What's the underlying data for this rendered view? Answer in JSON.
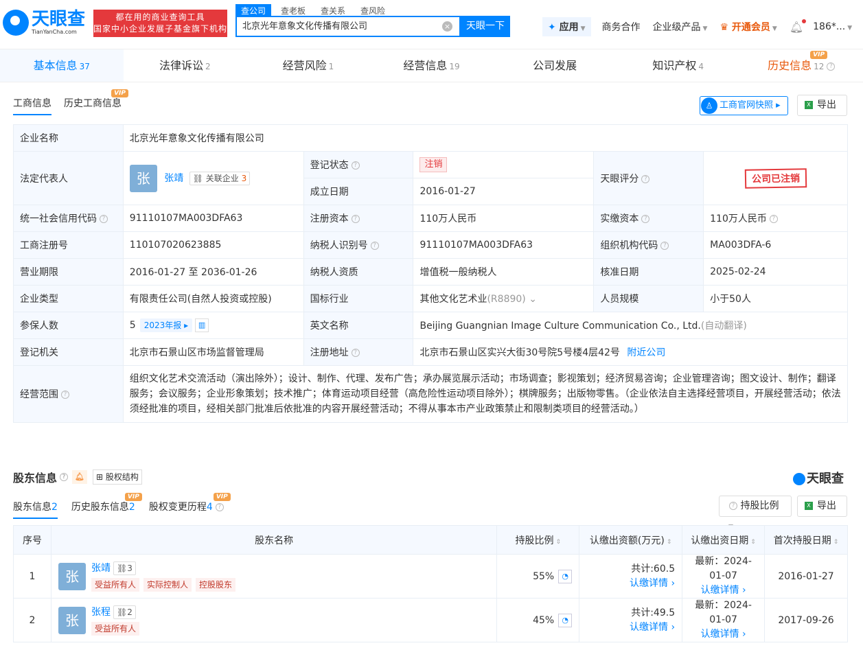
{
  "header": {
    "logo_cn": "天眼查",
    "logo_en": "TianYanCha.com",
    "promo_line1": "都在用的商业查询工具",
    "promo_line2": "国家中小企业发展子基金旗下机构",
    "search_tabs": [
      "查公司",
      "查老板",
      "查关系",
      "查风险"
    ],
    "search_value": "北京光年意象文化传播有限公司",
    "search_button": "天眼一下",
    "app_label": "应用",
    "nav_business": "商务合作",
    "nav_enterprise": "企业级产品",
    "nav_vip": "开通会员",
    "user": "186*..."
  },
  "main_tabs": [
    {
      "label": "基本信息",
      "count": "37"
    },
    {
      "label": "法律诉讼",
      "count": "2"
    },
    {
      "label": "经营风险",
      "count": "1"
    },
    {
      "label": "经营信息",
      "count": "19"
    },
    {
      "label": "公司发展",
      "count": ""
    },
    {
      "label": "知识产权",
      "count": "4"
    },
    {
      "label": "历史信息",
      "count": "12"
    }
  ],
  "vip_tag": "VIP",
  "subtabs": {
    "biz": "工商信息",
    "hist": "历史工商信息"
  },
  "buttons": {
    "snapshot": "工商官网快照",
    "export": "导出"
  },
  "info": {
    "name_k": "企业名称",
    "name_v": "北京光年意象文化传播有限公司",
    "legal_k": "法定代表人",
    "legal_avatar": "张",
    "legal_name": "张靖",
    "legal_rel": "关联企业",
    "legal_rel_count": "3",
    "status_k": "登记状态",
    "status_v": "注销",
    "score_k": "天眼评分",
    "score_stamp": "公司已注销",
    "found_k": "成立日期",
    "found_v": "2016-01-27",
    "credit_k": "统一社会信用代码",
    "credit_v": "91110107MA003DFA63",
    "capital_k": "注册资本",
    "capital_v": "110万人民币",
    "paid_k": "实缴资本",
    "paid_v": "110万人民币",
    "regno_k": "工商注册号",
    "regno_v": "110107020623885",
    "taxid_k": "纳税人识别号",
    "taxid_v": "91110107MA003DFA63",
    "orgcode_k": "组织机构代码",
    "orgcode_v": "MA003DFA-6",
    "term_k": "营业期限",
    "term_v": "2016-01-27 至 2036-01-26",
    "taxq_k": "纳税人资质",
    "taxq_v": "增值税一般纳税人",
    "approve_k": "核准日期",
    "approve_v": "2025-02-24",
    "type_k": "企业类型",
    "type_v": "有限责任公司(自然人投资或控股)",
    "industry_k": "国标行业",
    "industry_v": "其他文化艺术业",
    "industry_code": "(R8890)",
    "staff_k": "人员规模",
    "staff_v": "小于50人",
    "insured_k": "参保人数",
    "insured_v": "5",
    "insured_year": "2023年报",
    "en_k": "英文名称",
    "en_v": "Beijing Guangnian Image Culture Communication Co., Ltd.",
    "en_note": "(自动翻译)",
    "auth_k": "登记机关",
    "auth_v": "北京市石景山区市场监督管理局",
    "addr_k": "注册地址",
    "addr_v": "北京市石景山区实兴大街30号院5号楼4层42号",
    "addr_link": "附近公司",
    "scope_k": "经营范围",
    "scope_v": "组织文化艺术交流活动（演出除外）；设计、制作、代理、发布广告；承办展览展示活动；市场调查；影视策划；经济贸易咨询；企业管理咨询；图文设计、制作；翻译服务；会议服务；企业形象策划；技术推广；体育运动项目经营（高危险性运动项目除外）；棋牌服务；出版物零售。（企业依法自主选择经营项目，开展经营活动；依法须经批准的项目，经相关部门批准后依批准的内容开展经营活动；不得从事本市产业政策禁止和限制类项目的经营活动。）"
  },
  "shareholders": {
    "title": "股东信息",
    "equity_btn": "股权结构",
    "brand": "天眼查",
    "tabs": [
      {
        "label": "股东信息",
        "count": "2"
      },
      {
        "label": "历史股东信息",
        "count": "2"
      },
      {
        "label": "股权变更历程",
        "count": "4"
      }
    ],
    "ratio_btn": "持股比例",
    "export": "导出",
    "headers": [
      "序号",
      "股东名称",
      "持股比例",
      "认缴出资额(万元)",
      "认缴出资日期",
      "首次持股日期"
    ],
    "rows": [
      {
        "no": "1",
        "avatar": "张",
        "name": "张靖",
        "rel": "3",
        "tags": [
          "受益所有人",
          "实际控制人",
          "控股股东"
        ],
        "ratio": "55%",
        "amount": "共计:60.5",
        "detail": "认缴详情",
        "date_label": "最新：2024-01-07",
        "first": "2016-01-27"
      },
      {
        "no": "2",
        "avatar": "张",
        "name": "张程",
        "rel": "2",
        "tags": [
          "受益所有人"
        ],
        "ratio": "45%",
        "amount": "共计:49.5",
        "detail": "认缴详情",
        "date_label": "最新：2024-01-07",
        "first": "2017-09-26"
      }
    ]
  }
}
